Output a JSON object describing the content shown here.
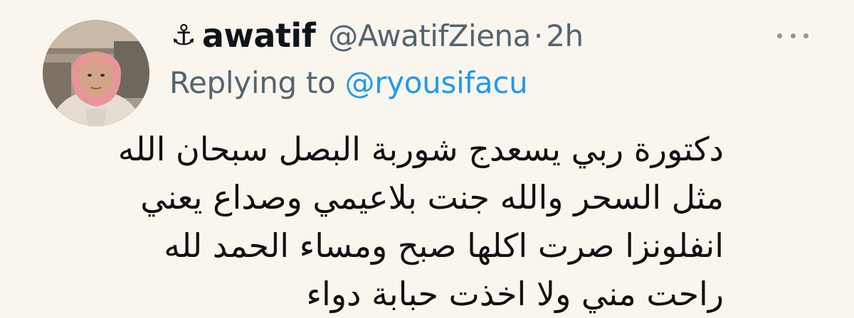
{
  "tweet": {
    "author": {
      "emoji": "⚓",
      "display_name": "awatif",
      "handle": "@AwatifZiena"
    },
    "separator": "·",
    "time": "2h",
    "replying_prefix": "Replying to ",
    "replying_to": "@ryousifacu",
    "text_lines": [
      "دكتورة ربي يسعدج شوربة البصل سبحان الله",
      "مثل السحر والله جنت بلاعيمي وصداع يعني",
      "انفلونزا صرت اكلها صبح ومساء الحمد لله",
      "راحت مني ولا اخذت حبابة دواء"
    ]
  },
  "icons": {
    "more": "more-options-icon"
  },
  "colors": {
    "background": "#fbf6ed",
    "secondary_text": "#536471",
    "link": "#1d9bf0",
    "hijab": "#e8959a"
  }
}
